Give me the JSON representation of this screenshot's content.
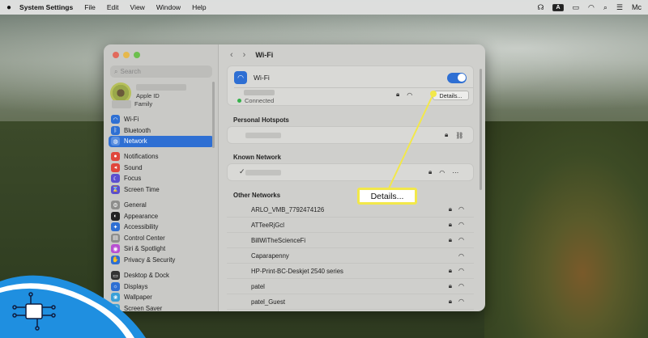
{
  "menubar": {
    "app_name": "System Settings",
    "items": [
      "File",
      "Edit",
      "View",
      "Window",
      "Help"
    ],
    "input_badge": "A",
    "user_partial": "Mc"
  },
  "sidebar": {
    "search_placeholder": "Search",
    "account": {
      "label": "Apple ID"
    },
    "family_label": "Family",
    "items": [
      {
        "label": "Wi-Fi",
        "icon": "wifi-icon",
        "color": "#2e6fd3",
        "glyph": "◠"
      },
      {
        "label": "Bluetooth",
        "icon": "bluetooth-icon",
        "color": "#2e6fd3",
        "glyph": "ᛒ"
      },
      {
        "label": "Network",
        "icon": "network-icon",
        "color": "#2e6fd3",
        "glyph": "◍",
        "selected": true
      },
      {
        "label": "Notifications",
        "icon": "notifications-icon",
        "color": "#e0473c",
        "glyph": "●"
      },
      {
        "label": "Sound",
        "icon": "sound-icon",
        "color": "#e0473c",
        "glyph": "◂"
      },
      {
        "label": "Focus",
        "icon": "focus-icon",
        "color": "#5b4fcf",
        "glyph": "☾"
      },
      {
        "label": "Screen Time",
        "icon": "screen-time-icon",
        "color": "#5b4fcf",
        "glyph": "⌛"
      },
      {
        "label": "General",
        "icon": "general-icon",
        "color": "#8e8e8c",
        "glyph": "⚙"
      },
      {
        "label": "Appearance",
        "icon": "appearance-icon",
        "color": "#222222",
        "glyph": "◐"
      },
      {
        "label": "Accessibility",
        "icon": "accessibility-icon",
        "color": "#2e6fd3",
        "glyph": "✦"
      },
      {
        "label": "Control Center",
        "icon": "control-center-icon",
        "color": "#8e8e8c",
        "glyph": "▤"
      },
      {
        "label": "Siri & Spotlight",
        "icon": "siri-icon",
        "color": "#b84fd1",
        "glyph": "◉"
      },
      {
        "label": "Privacy & Security",
        "icon": "privacy-icon",
        "color": "#2e6fd3",
        "glyph": "✋"
      },
      {
        "label": "Desktop & Dock",
        "icon": "desktop-dock-icon",
        "color": "#333333",
        "glyph": "▭"
      },
      {
        "label": "Displays",
        "icon": "displays-icon",
        "color": "#2e6fd3",
        "glyph": "☼"
      },
      {
        "label": "Wallpaper",
        "icon": "wallpaper-icon",
        "color": "#3aa0d8",
        "glyph": "❀"
      },
      {
        "label": "Screen Saver",
        "icon": "screen-saver-icon",
        "color": "#3aa0d8",
        "glyph": "▢"
      }
    ]
  },
  "content": {
    "title": "Wi-Fi",
    "wifi_label": "Wi-Fi",
    "wifi_enabled": true,
    "connected_label": "Connected",
    "details_button": "Details...",
    "personal_hotspots_title": "Personal Hotspots",
    "known_network_title": "Known Network",
    "other_networks_title": "Other Networks",
    "other_networks": [
      "ARLO_VMB_7792474126",
      "ATTeeRjGcl",
      "BillWiTheScienceFi",
      "Caparapenny",
      "HP-Print-BC-Deskjet 2540 series",
      "patel",
      "patel_Guest"
    ]
  },
  "annotation": {
    "callout_text": "Details...",
    "color": "#f2e84a"
  }
}
